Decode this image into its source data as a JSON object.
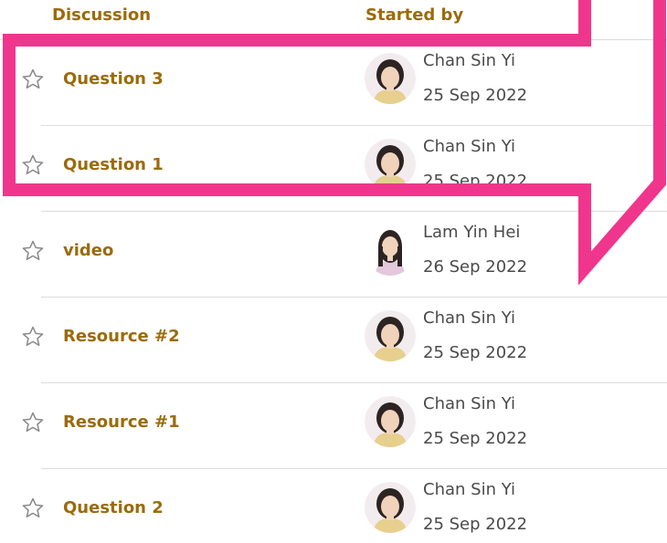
{
  "header": {
    "discussion_label": "Discussion",
    "started_by_label": "Started by"
  },
  "rows": [
    {
      "title": "Question 3",
      "author": "Chan Sin Yi",
      "date": "25 Sep 2022",
      "avatar": "chan"
    },
    {
      "title": "Question 1",
      "author": "Chan Sin Yi",
      "date": "25 Sep 2022",
      "avatar": "chan"
    },
    {
      "title": "video",
      "author": "Lam Yin Hei",
      "date": "26 Sep 2022",
      "avatar": "lam"
    },
    {
      "title": "Resource #2",
      "author": "Chan Sin Yi",
      "date": "25 Sep 2022",
      "avatar": "chan"
    },
    {
      "title": "Resource #1",
      "author": "Chan Sin Yi",
      "date": "25 Sep 2022",
      "avatar": "chan"
    },
    {
      "title": "Question 2",
      "author": "Chan Sin Yi",
      "date": "25 Sep 2022",
      "avatar": "chan"
    }
  ],
  "colors": {
    "link": "#9a6b0c",
    "text": "#4a4a4a",
    "highlight": "#f0368c"
  },
  "icons": {
    "star": "star-outline-icon",
    "arrow": "callout-arrow"
  }
}
